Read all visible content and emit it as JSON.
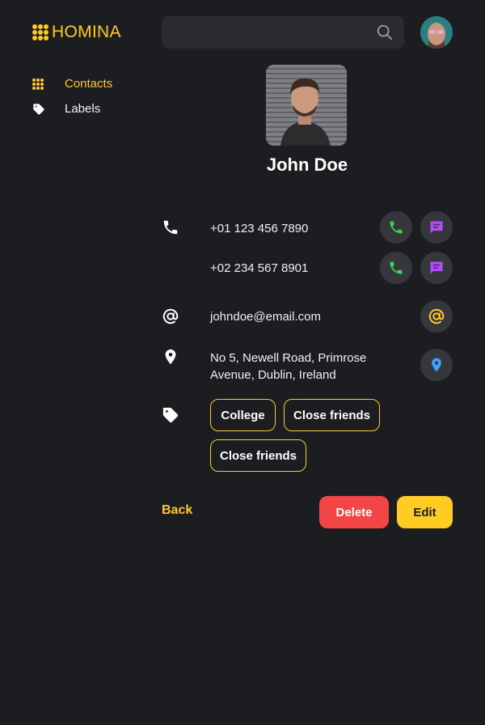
{
  "app": {
    "name": "HOMINA"
  },
  "colors": {
    "accent": "#ffc927",
    "call": "#39d353",
    "message": "#b44bff",
    "location": "#3fa4ff",
    "delete": "#f24646",
    "background": "#1c1d21"
  },
  "sidebar": {
    "items": [
      {
        "label": "Contacts",
        "icon": "grid-icon",
        "active": true
      },
      {
        "label": "Labels",
        "icon": "tag-icon",
        "active": false
      }
    ]
  },
  "search": {
    "placeholder": "",
    "value": ""
  },
  "contact": {
    "name": "John Doe",
    "phones": [
      "+01 123 456 7890",
      "+02 234 567 8901"
    ],
    "email": "johndoe@email.com",
    "address_line1": "No 5, Newell Road, Primrose",
    "address_line2": "Avenue, Dublin, Ireland",
    "labels": [
      "College",
      "Close friends",
      "Close friends"
    ]
  },
  "actions": {
    "back": "Back",
    "delete": "Delete",
    "edit": "Edit"
  }
}
